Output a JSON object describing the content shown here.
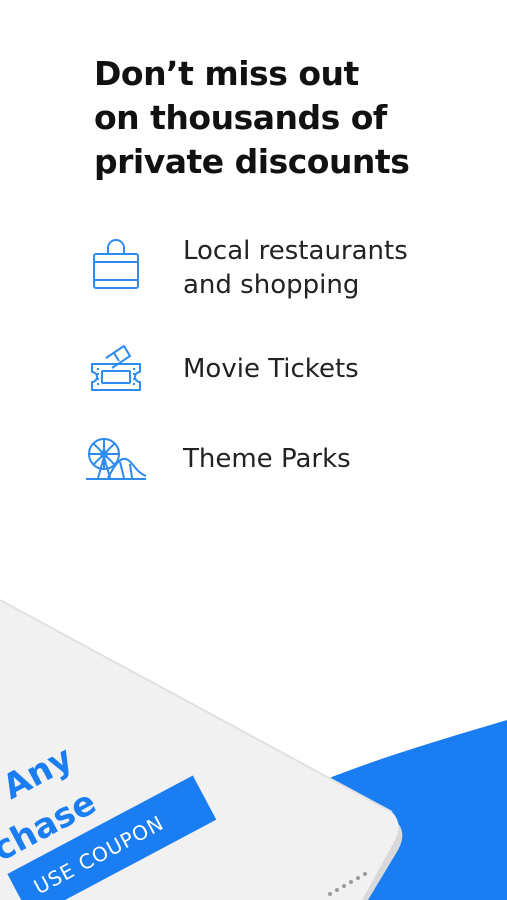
{
  "headline": {
    "lines": [
      "Don’t miss out",
      "on thousands of",
      "private discounts"
    ]
  },
  "features": [
    {
      "icon": "shopping-bag-icon",
      "lines": [
        "Local restaurants",
        "and shopping"
      ]
    },
    {
      "icon": "movie-ticket-icon",
      "lines": [
        "Movie Tickets"
      ]
    },
    {
      "icon": "ferris-wheel-icon",
      "lines": [
        "Theme Parks"
      ]
    }
  ],
  "promo": {
    "line1": "Any",
    "line2": "chase",
    "coupon_label": "USE COUPON"
  },
  "colors": {
    "accent": "#1a7ef2",
    "icon_stroke": "#2f8bf0",
    "phone_body": "#f1f1f2",
    "text": "#111111"
  }
}
